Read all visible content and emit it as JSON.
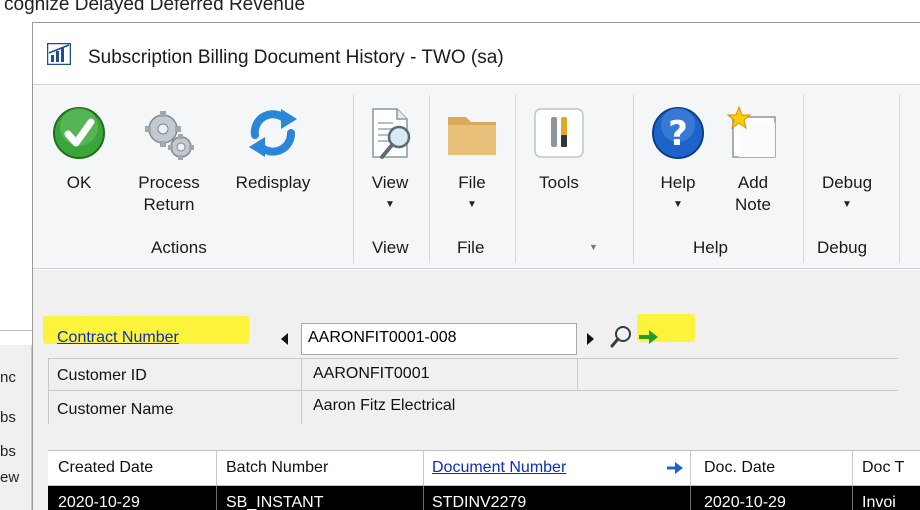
{
  "background": {
    "title": "cognize Delayed Deferred Revenue",
    "strip_items": [
      "nc",
      "bs",
      "bs",
      "ew"
    ]
  },
  "window": {
    "title": "Subscription Billing Document History  -  TWO (sa)"
  },
  "ribbon": {
    "buttons": {
      "ok": "OK",
      "process_return_1": "Process",
      "process_return_2": "Return",
      "redisplay": "Redisplay",
      "view": "View",
      "file": "File",
      "tools": "Tools",
      "help": "Help",
      "add_note_1": "Add",
      "add_note_2": "Note",
      "debug": "Debug"
    },
    "groups": {
      "actions": "Actions",
      "view": "View",
      "file": "File",
      "help": "Help",
      "debug": "Debug"
    },
    "colors": {
      "accent_green": "#3aa63a",
      "help_blue": "#1e63c9",
      "redisplay_blue": "#2a86d9",
      "highlight": "#fdf33b"
    }
  },
  "form": {
    "contract_number_label": "Contract Number",
    "contract_number_value": "AARONFIT0001-008",
    "customer_id_label": "Customer ID",
    "customer_id_value": "AARONFIT0001",
    "customer_name_label": "Customer Name",
    "customer_name_value": "Aaron Fitz Electrical"
  },
  "table": {
    "columns": [
      "Created Date",
      "Batch Number",
      "Document Number",
      "Doc. Date",
      "Doc T"
    ],
    "rows": [
      [
        "2020-10-29",
        "SB_INSTANT",
        "STDINV2279",
        "2020-10-29",
        "Invoi"
      ]
    ]
  }
}
